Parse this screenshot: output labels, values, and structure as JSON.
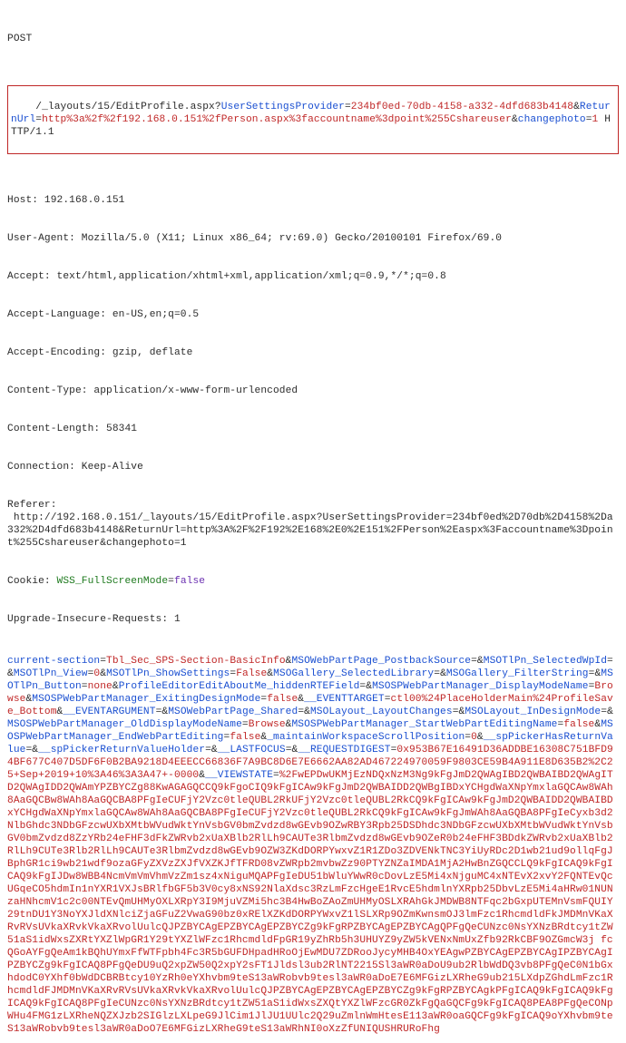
{
  "request": {
    "method": "POST",
    "line": {
      "pathPrefix": "/_layouts/15/EditProfile.aspx?",
      "p1_name": "UserSettingsProvider",
      "p1_val": "234bf0ed-70db-4158-a332-4dfd683b4148",
      "amp1": "&",
      "p2_name": "ReturnUrl",
      "p2_val": "http%3a%2f%2f192.168.0.151%2fPerson.aspx%3faccountname%3dpoint%255Cshareuser",
      "amp2": "&",
      "p3_name": "changephoto",
      "p3_val": "1",
      "httpVer": " HTTP/1.1"
    },
    "hdr_host_label": "Host:",
    "hdr_host_val": " 192.168.0.151",
    "hdr_ua_label": "User-Agent:",
    "hdr_ua_val": " Mozilla/5.0 (X11; Linux x86_64; rv:69.0) Gecko/20100101 Firefox/69.0",
    "hdr_accept_label": "Accept:",
    "hdr_accept_val": " text/html,application/xhtml+xml,application/xml;q=0.9,*/*;q=0.8",
    "hdr_acclang_label": "Accept-Language:",
    "hdr_acclang_val": " en-US,en;q=0.5",
    "hdr_accenc_label": "Accept-Encoding:",
    "hdr_accenc_val": " gzip, deflate",
    "hdr_ctype_label": "Content-Type:",
    "hdr_ctype_val": " application/x-www-form-urlencoded",
    "hdr_clen_label": "Content-Length:",
    "hdr_clen_val": " 58341",
    "hdr_conn_label": "Connection:",
    "hdr_conn_val": " Keep-Alive",
    "hdr_ref_label": "Referer:",
    "hdr_ref_val": " http://192.168.0.151/_layouts/15/EditProfile.aspx?UserSettingsProvider=234bf0ed%2D70db%2D4158%2Da332%2D4dfd683b4148&ReturnUrl=http%3A%2F%2F192%2E168%2E0%2E151%2FPerson%2Easpx%3Faccountname%3Dpoint%255Cshareuser&changephoto=1",
    "hdr_cookie_label": "Cookie:",
    "hdr_cookie_k": " WSS_FullScreenMode",
    "hdr_cookie_eq": "=",
    "hdr_cookie_v": "false",
    "hdr_uir_label": "Upgrade-Insecure-Requests:",
    "hdr_uir_val": " 1"
  },
  "body": {
    "t01": "current-section",
    "e01": "=",
    "v01": "Tbl_Sec_SPS-Section-BasicInfo",
    "a01": "&",
    "t02": "MSOWebPartPage_PostbackSource",
    "e02": "=",
    "a02": "&",
    "t03": "MSOTlPn_SelectedWpId",
    "e03": "=",
    "a03": "&",
    "t04": "MSOTlPn_View",
    "e04": "=",
    "v04": "0",
    "a04": "&",
    "t05": "MSOTlPn_ShowSettings",
    "e05": "=",
    "v05": "False",
    "a05": "&",
    "t06": "MSOGallery_SelectedLibrary",
    "e06": "=",
    "a06": "&",
    "t07": "MSOGallery_FilterString",
    "e07": "=",
    "a07": "&",
    "t08": "MSOTlPn_Button",
    "e08": "=",
    "v08": "none",
    "a08": "&",
    "t09": "ProfileEditorEditAboutMe_hiddenRTEField",
    "e09": "=",
    "a09": "&",
    "t10": "MSOSPWebPartManager_DisplayModeName",
    "e10": "=",
    "v10": "Browse",
    "a10": "&",
    "t11": "MSOSPWebPartManager_ExitingDesignMode",
    "e11": "=",
    "v11": "false",
    "a11": "&",
    "t12": "__EVENTTARGET",
    "e12": "=",
    "v12": "ctl00%24PlaceHolderMain%24ProfileSave_Bottom",
    "a12": "&",
    "t13": "__EVENTARGUMENT",
    "e13": "=",
    "a13": "&",
    "t14": "MSOWebPartPage_Shared",
    "e14": "=",
    "a14": "&",
    "t15": "MSOLayout_LayoutChanges",
    "e15": "=",
    "a15": "&",
    "t16": "MSOLayout_InDesignMode",
    "e16": "=",
    "a16": "&",
    "t17": "MSOSPWebPartManager_OldDisplayModeName",
    "e17": "=",
    "v17": "Browse",
    "a17": "&",
    "t18": "MSOSPWebPartManager_StartWebPartEditingName",
    "e18": "=",
    "v18": "false",
    "a18": "&",
    "t19": "MSOSPWebPartManager_EndWebPartEditing",
    "e19": "=",
    "v19": "false",
    "a19": "&",
    "t20": "_maintainWorkspaceScrollPosition",
    "e20": "=",
    "v20": "0",
    "a20": "&",
    "t21": "__spPickerHasReturnValue",
    "e21": "=",
    "a21": "&",
    "t22": "__spPickerReturnValueHolder",
    "e22": "=",
    "a22": "&",
    "t23": "__LASTFOCUS",
    "e23": "=",
    "a23": "&",
    "t24": "__REQUESTDIGEST",
    "e24": "=",
    "v24": "0x953B67E16491D36ADDBE16308C751BFD94BF677C407D5DF6F0B2BA9218D4EEECC66836F7A9BC8D6E7E6662AA82AD467224970059F9803CE59B4A911E8D635B2%2C25+Sep+2019+10%3A46%3A3A47+-0000",
    "a24": "&",
    "t25": "__VIEWSTATE",
    "e25": "=",
    "v25": "%2FwEPDwUKMjEzNDQxNzM3Ng9kFgJmD2QWAgIBD2QWBAIBD2QWAgITD2QWAgIDD2QWAmYPZBYCZg88KwAGAGQCCQ9kFgoCIQ9kFgICAw9kFgJmD2QWBAIDD2QWBgIBDxYCHgdWaXNpYmxlaGQCAw8WAh8AaGQCBw8WAh8AaGQCBA8PFgIeCUFjY2Vzc0tleQUBL2RkUFjY2Vzc0tleQUBL2RkCQ9kFgICAw9kFgJmD2QWBAIDD2QWBAIBDxYCHgdWaXNpYmxlaGQCAw8WAh8AaGQCBA8PFgIeCUFjY2Vzc0tleQUBL2RkCQ9kFgICAw9kFgJmWAh8AaGQBA8PFgIeCyxb3d2NlbGhdc3NDbGFzcwUXbXMtbWVudWktYnVsbGV0bmZvdzd8wGEvb9OZwRBY3Rpb25DSDhdc3NDbGFzcwUXbXMtbWVudWktYnVsbGV0bmZvdzd8ZzYRb24eFHF3dFkZWRvb2xUaXBlb2RlLh9CAUTe3RlbmZvdzd8wGEvb9OZeR0b24eFHF3BDdkZWRvb2xUaXBlb2RlLh9CUTe3Rlb2RlLh9CAUTe3RlbmZvdzd8wGEvb9OZW3ZKdDORPYwxvZ1R1ZDo3ZDVENkTNC3YiUyRDc2D1wb21ud9ollqFgJBphGR1ci9wb21wdf9ozaGFyZXVzZXJfVXZKJfTFRD08vZWRpb2mvbwZz90PTYZNZaIMDA1MjA2HwBnZGQCCLQ9kFgICAQ9kFgICAQ9kFgIJDw8WBB4NcmVmVmVhmVzZm1sz4xNiguMQAPFgIeDU51bWluYWwR0cDovLzE5Mi4xNjguMC4xNTEvX2xvY2FQNTEvQcUGqeCO5hdmIn1nYXR1VXJsBRlfbGF5b3V0cy8xNS92NlaXdsc3RzLmFzcHgeE1RvcE5hdmlnYXRpb25DbvLzE5Mi4aHRw01NUNzaHNhcmV1c2c00NTEvQmUHMyOXLXRpY3I9MjuVZMi5hc3B4HwBoZAoZmUHMyOSLXRAhGkJMDWB8NTFqc2bGxpUTEMnVsmFQUIY29tnDU1Y3NoYXJldXNlciZjaGFuZ2VwaG90bz0xRElXZKdDORPYWxvZ1lSLXRp9OZmKwnsmOJ3lmFzc1RhcmdldFkJMDMnVKaXRvRVsUVkaXRvkVkaXRvolUulcQJPZBYCAgEPZBYCAgEPZBYCZg9kFgRPZBYCAgEPZBYCAgQPFgQeCUNzc0NsYXNzBRdtcy1tZW51aS1idWxsZXRtYXZlWpGR1Y29tYXZlWFzc1RhcmdldFpGR19yZhRb5h3UHUYZ9yZW5kVENxNmUxZfb92RkCBF9OZGmcW3j fcQGoAYFgQeAm1kBQhUYmxFfWTFpbh4Fc3R5bGUFDHpadHRoOjEwMDU7ZDRooJycyMHB4OxYEAgwPZBYCAgEPZBYCAgIPZBYCAgIPZBYCZg9kFgICAQ8PFgQeDU9uQ2xpZW50Q2xpY2sFT1Jldsl3ub2RlNT2215Sl3aWR0aDoU9ub2RlbWdDQ3vb8PFgQeC0N1bGxhdodC0YXhf0bWdDCBRBtcy10YzRh0eYXhvbm9teS13aWRobvb9tesl3aWR0aDoE7E6MFGizLXRheG9ub215LXdpZGhdLmFzc1RhcmdldFJMDMnVKaXRvRVsUVkaXRvkVkaXRvolUulcQJPZBYCAgEPZBYCAgEPZBYCZg9kFgRPZBYCAgkPFgICAQ9kFgICAQ9kFgICAQ9kFgICAQ8PFgIeCUNzc0NsYXNzBRdtcy1tZW51aS1idWxsZXQtYXZlWFzcGR0ZkFgQaGQCFg9kFgICAQ8PEA8PFgQeCONpWHu4FMG1zLXRheNQZXJzb2SIGlzLXLpeG9JlCim1JlJU1UUlc2Q29uZmlnWmHtesE113aWR0oaGQCFg9kFgICAQ9oYXhvbm9teS13aWRobvb9tesl3aWR0aDoO7E6MFGizLXRheG9teS13aWRhNI0oXzZfUNIQUSHRURoFhg"
  }
}
